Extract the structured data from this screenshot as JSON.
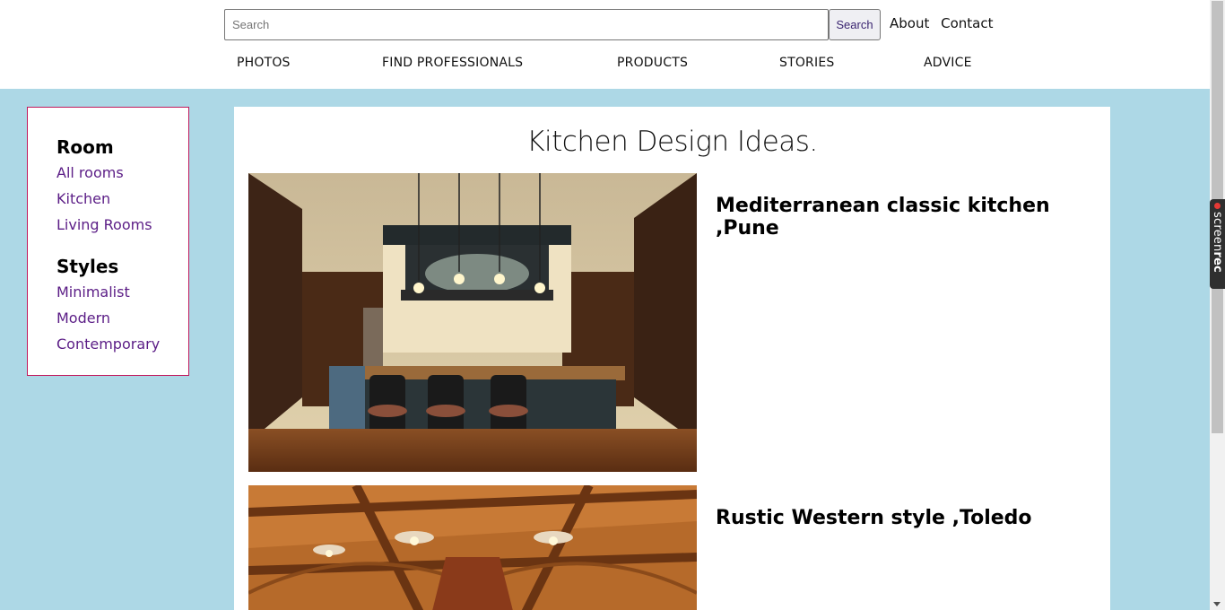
{
  "header": {
    "search": {
      "placeholder": "Search",
      "button_label": "Search"
    },
    "links": [
      "About",
      "Contact"
    ],
    "nav": [
      "PHOTOS",
      "FIND PROFESSIONALS",
      "PRODUCTS",
      "STORIES",
      "ADVICE"
    ]
  },
  "sidebar": {
    "room_heading": "Room",
    "room_links": [
      "All rooms",
      "Kitchen",
      "Living Rooms"
    ],
    "styles_heading": "Styles",
    "styles_links": [
      "Minimalist",
      "Modern",
      "Contemporary"
    ]
  },
  "main": {
    "title": "Kitchen Design Ideas.",
    "cards": [
      {
        "title": "Mediterranean classic kitchen ,Pune",
        "image": "kitchen-photo"
      },
      {
        "title": "Rustic Western style ,Toledo",
        "image": "kitchen-photo"
      }
    ]
  },
  "overlay": {
    "recorder_label_light": "screen",
    "recorder_label_bold": "rec"
  },
  "colors": {
    "page_background": "#add8e6",
    "sidebar_border": "#c2185b",
    "link_color": "#5b1d86",
    "button_text": "#3a2470"
  }
}
